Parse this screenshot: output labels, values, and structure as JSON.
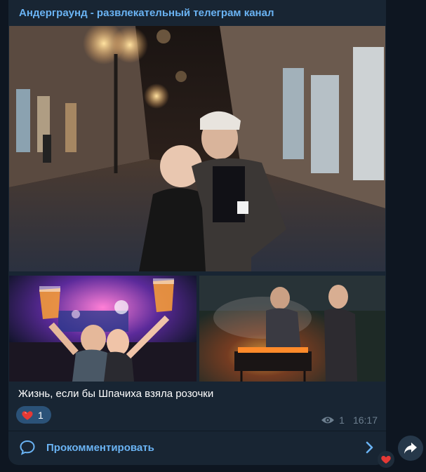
{
  "post": {
    "channel_name": "Андерграунд - развлекательный телеграм канал",
    "caption": "Жизнь, если бы Шпачиха взяла розочки",
    "reaction": {
      "icon": "heart-icon",
      "count": "1"
    },
    "views": "1",
    "time": "16:17",
    "comment_label": "Прокомментировать"
  },
  "icons": {
    "eye": "eye-icon",
    "comment": "comment-bubble-icon",
    "chevron": "chevron-right-icon",
    "share": "share-arrow-icon",
    "floating_reaction": "heart-icon"
  },
  "colors": {
    "background": "#0e1621",
    "bubble": "#182533",
    "accent": "#6ab3f3",
    "reaction_pill": "#2b5278",
    "meta_text": "#6d7f8f",
    "heart": "#e53935"
  }
}
